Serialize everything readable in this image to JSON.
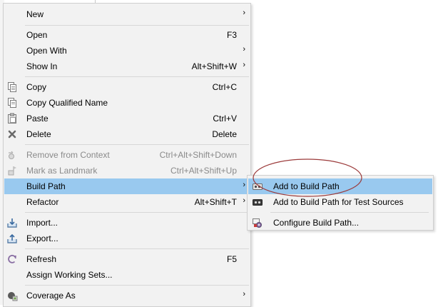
{
  "menu": {
    "items": [
      {
        "label": "New",
        "accel": "",
        "arrow": "›",
        "icon": "",
        "disabled": false,
        "highlight": false
      },
      {
        "label": "Open",
        "accel": "F3",
        "arrow": "",
        "icon": "",
        "disabled": false,
        "highlight": false
      },
      {
        "label": "Open With",
        "accel": "",
        "arrow": "›",
        "icon": "",
        "disabled": false,
        "highlight": false
      },
      {
        "label": "Show In",
        "accel": "Alt+Shift+W",
        "arrow": "›",
        "icon": "",
        "disabled": false,
        "highlight": false
      },
      {
        "label": "Copy",
        "accel": "Ctrl+C",
        "arrow": "",
        "icon": "copy-icon",
        "disabled": false,
        "highlight": false
      },
      {
        "label": "Copy Qualified Name",
        "accel": "",
        "arrow": "",
        "icon": "copy-qualified-name-icon",
        "disabled": false,
        "highlight": false
      },
      {
        "label": "Paste",
        "accel": "Ctrl+V",
        "arrow": "",
        "icon": "paste-icon",
        "disabled": false,
        "highlight": false
      },
      {
        "label": "Delete",
        "accel": "Delete",
        "arrow": "",
        "icon": "delete-icon",
        "disabled": false,
        "highlight": false
      },
      {
        "label": "Remove from Context",
        "accel": "Ctrl+Alt+Shift+Down",
        "arrow": "",
        "icon": "remove-context-icon",
        "disabled": true,
        "highlight": false
      },
      {
        "label": "Mark as Landmark",
        "accel": "Ctrl+Alt+Shift+Up",
        "arrow": "",
        "icon": "landmark-icon",
        "disabled": true,
        "highlight": false
      },
      {
        "label": "Build Path",
        "accel": "",
        "arrow": "›",
        "icon": "",
        "disabled": false,
        "highlight": true
      },
      {
        "label": "Refactor",
        "accel": "Alt+Shift+T",
        "arrow": "›",
        "icon": "",
        "disabled": false,
        "highlight": false
      },
      {
        "label": "Import...",
        "accel": "",
        "arrow": "",
        "icon": "import-icon",
        "disabled": false,
        "highlight": false
      },
      {
        "label": "Export...",
        "accel": "",
        "arrow": "",
        "icon": "export-icon",
        "disabled": false,
        "highlight": false
      },
      {
        "label": "Refresh",
        "accel": "F5",
        "arrow": "",
        "icon": "refresh-icon",
        "disabled": false,
        "highlight": false
      },
      {
        "label": "Assign Working Sets...",
        "accel": "",
        "arrow": "",
        "icon": "",
        "disabled": false,
        "highlight": false
      },
      {
        "label": "Coverage As",
        "accel": "",
        "arrow": "›",
        "icon": "coverage-icon",
        "disabled": false,
        "highlight": false
      }
    ]
  },
  "submenu": {
    "items": [
      {
        "label": "Add to Build Path",
        "icon": "add-to-build-path-icon",
        "highlight": true
      },
      {
        "label": "Add to Build Path for Test Sources",
        "icon": "add-test-build-path-icon",
        "highlight": false
      },
      {
        "label": "Configure Build Path...",
        "icon": "configure-build-path-icon",
        "highlight": false
      }
    ]
  },
  "colors": {
    "menu_bg": "#f2f2f2",
    "highlight": "#99c9ef",
    "disabled_text": "#8a8a8a",
    "annotation_ellipse": "#9b3a3a"
  }
}
